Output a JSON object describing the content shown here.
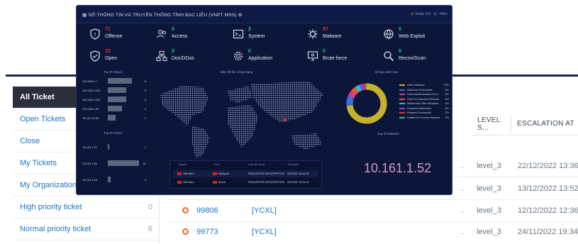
{
  "ticket_app": {
    "sidebar": [
      {
        "label": "All Ticket",
        "count": "",
        "active": true
      },
      {
        "label": "Open Tickets",
        "count": ""
      },
      {
        "label": "Close",
        "count": ""
      },
      {
        "label": "My Tickets",
        "count": ""
      },
      {
        "label": "My Organization",
        "count": ""
      },
      {
        "label": "High priority ticket",
        "count": "0"
      },
      {
        "label": "Normal priority ticket",
        "count": "6"
      }
    ],
    "columns": {
      "level": "LEVEL S...",
      "escalation": "ESCALATION AT"
    },
    "rows": [
      {
        "id": "",
        "code": "",
        "dots": "..",
        "level": "level_3",
        "escalation": "22/12/2022 13:36"
      },
      {
        "id": "",
        "code": "",
        "dots": "..",
        "level": "level_3",
        "escalation": "13/12/2022 13:52"
      },
      {
        "id": "99806",
        "code": "[YCXL]",
        "dots": "..",
        "level": "level_3",
        "escalation": "12/12/2022 12:36"
      },
      {
        "id": "99773",
        "code": "[YCXL]",
        "dots": "..",
        "level": "level_3",
        "escalation": "24/11/2022 19:34"
      }
    ]
  },
  "dashboard": {
    "title": "SỞ THÔNG TIN VÀ TRUYỀN THÔNG TỈNH BẠC LIÊU (VNPT MSS)",
    "controls": "Today (Vi) · Q · Filter",
    "stats": [
      {
        "value": "71",
        "label": "Offense",
        "icon": "shield-icon",
        "color": "#e0343a"
      },
      {
        "value": "0",
        "label": "Access",
        "icon": "users-icon",
        "color": "#27c27a"
      },
      {
        "value": "2",
        "label": "System",
        "icon": "terminal-icon",
        "color": "#27c27a"
      },
      {
        "value": "67",
        "label": "Malware",
        "icon": "virus-icon",
        "color": "#e0343a"
      },
      {
        "value": "0",
        "label": "Web Exploit",
        "icon": "globe-icon",
        "color": "#27c27a"
      },
      {
        "value": "23",
        "label": "Open",
        "icon": "shield-check-icon",
        "color": "#e0343a"
      },
      {
        "value": "0",
        "label": "Dos/DDos",
        "icon": "network-icon",
        "color": "#27c27a"
      },
      {
        "value": "0",
        "label": "Application",
        "icon": "gear-icon",
        "color": "#27c27a"
      },
      {
        "value": "0",
        "label": "Brute force",
        "icon": "monitor-icon",
        "color": "#27c27a"
      },
      {
        "value": "0",
        "label": "Recon/Scan",
        "icon": "magnifier-icon",
        "color": "#27c27a"
      }
    ],
    "top_attack_title": "Top IP Attack",
    "top_attack": [
      {
        "ip": "192.168.1.7",
        "count": "8",
        "fill": 0.78
      },
      {
        "ip": "192.168.0.101",
        "count": "6",
        "fill": 0.6
      },
      {
        "ip": "192.168.0.102",
        "count": "6",
        "fill": 0.6
      },
      {
        "ip": "192.168.1.35",
        "count": "4",
        "fill": 0.45
      },
      {
        "ip": "10.162.32.83",
        "count": "2",
        "fill": 0.25
      }
    ],
    "top_victim_title": "Top IP Victim",
    "top_victim": [
      {
        "ip": "10.161.1.21",
        "count": "1",
        "fill": 0.05
      },
      {
        "ip": "10.161.1.52",
        "count": "67",
        "fill": 1.0
      },
      {
        "ip": "10.161.4.10",
        "count": "3",
        "fill": 0.08
      }
    ],
    "map_title": "Bản đồ tấn công mạng",
    "map_table": {
      "headers": [
        "Nguồn",
        "Đích",
        "Loại tấn công",
        "Thời gian"
      ],
      "rows": [
        {
          "src": "Việt Nam",
          "dst": "Malaysia",
          "type": "REQUESTED DESCRIPTION",
          "time": "3/2/2022 13:44:19"
        },
        {
          "src": "Việt Nam",
          "dst": "Brazil",
          "type": "REQUESTED DESCRIPTION",
          "time": "3/2/2022 13:44:19"
        }
      ]
    },
    "big_ip": "10.161.1.52",
    "donut_title": "Số loại cảnh báo",
    "donut_series": [
      {
        "name": "Other Malware",
        "value": 73,
        "color": "#c7b12c"
      },
      {
        "name": "Malicious Executable",
        "value": 8,
        "color": "#3a6fd8"
      },
      {
        "name": "Client Authentication Error",
        "value": 5,
        "color": "#d83a8f"
      },
      {
        "name": "Client Connection Refused",
        "value": 4,
        "color": "#e85a2a"
      },
      {
        "name": "Malformed Client Request",
        "value": 4,
        "color": "#2ab8d8"
      },
      {
        "name": "Request Redirected",
        "value": 3,
        "color": "#8e44d8"
      },
      {
        "name": "Request Successful",
        "value": 2,
        "color": "#e0343a"
      },
      {
        "name": "Unable to Process Request",
        "value": 1,
        "color": "#27c27a"
      }
    ],
    "legend_values": [
      "73%",
      "8%",
      "5%",
      "4%",
      "4%",
      "3%",
      "2%",
      "1%"
    ],
    "malware_title": "Top IP Malware"
  }
}
